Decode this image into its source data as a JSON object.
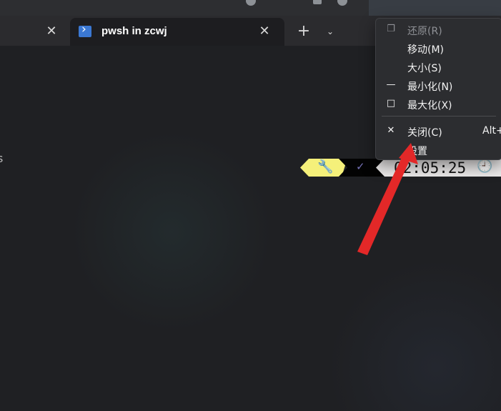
{
  "tab": {
    "title": "pwsh in zcwj"
  },
  "terminal": {
    "partial_text": "s"
  },
  "prompt": {
    "time": "02:05:25"
  },
  "context_menu": {
    "items": [
      {
        "label": "还原(R)",
        "shortcut": "",
        "icon": "restore-icon",
        "disabled": true
      },
      {
        "label": "移动(M)",
        "shortcut": "",
        "icon": "",
        "disabled": false
      },
      {
        "label": "大小(S)",
        "shortcut": "",
        "icon": "",
        "disabled": false
      },
      {
        "label": "最小化(N)",
        "shortcut": "",
        "icon": "minimize-icon",
        "disabled": false
      },
      {
        "label": "最大化(X)",
        "shortcut": "",
        "icon": "maximize-icon",
        "disabled": false
      },
      {
        "label": "关闭(C)",
        "shortcut": "Alt+",
        "icon": "close-icon",
        "disabled": false
      },
      {
        "label": "设置",
        "shortcut": "",
        "icon": "",
        "disabled": false
      }
    ]
  },
  "colors": {
    "accent_yellow": "#f5f07a",
    "arrow_red": "#e32828",
    "menu_background": "#2c2d30"
  }
}
